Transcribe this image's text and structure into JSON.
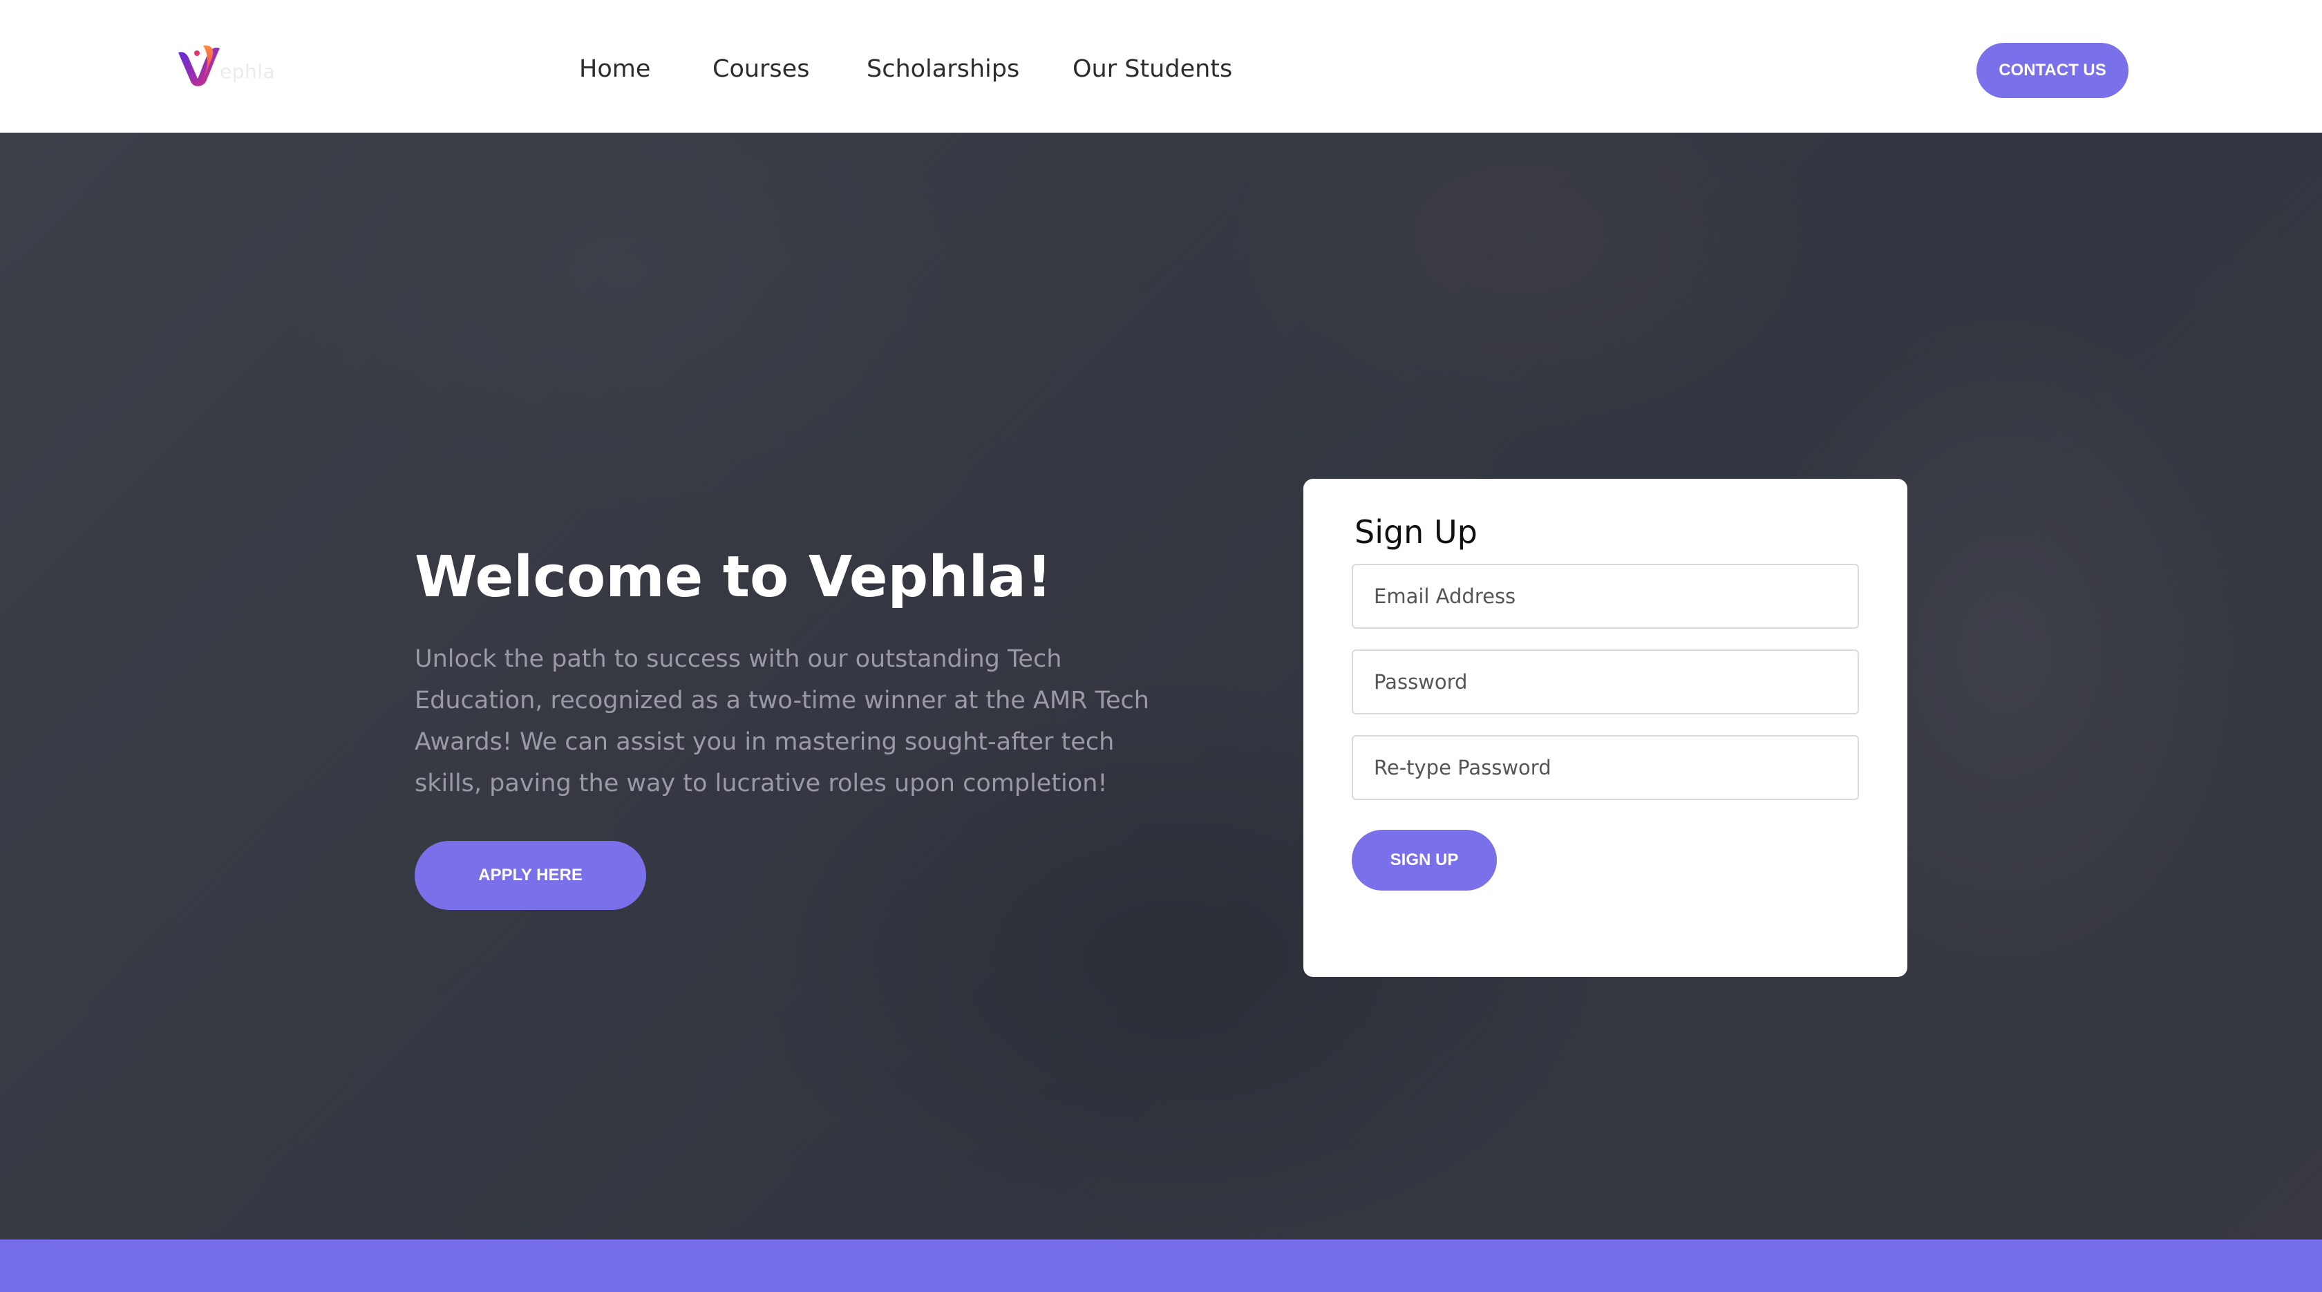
{
  "brand": {
    "logo_text": "ephla",
    "accent_color": "#7a70ea"
  },
  "nav": {
    "items": [
      {
        "label": "Home"
      },
      {
        "label": "Courses"
      },
      {
        "label": "Scholarships"
      },
      {
        "label": "Our Students"
      }
    ],
    "contact_label": "CONTACT US"
  },
  "hero": {
    "title": "Welcome to Vephla!",
    "description": "Unlock the path to success with our outstanding Tech Education, recognized as a two-time winner at the AMR Tech Awards! We can assist you in mastering sought-after tech skills, paving the way to lucrative roles upon completion!",
    "apply_label": "APPLY HERE"
  },
  "signup": {
    "title": "Sign Up",
    "email_placeholder": "Email Address",
    "password_placeholder": "Password",
    "retype_placeholder": "Re-type Password",
    "button_label": "SIGN UP"
  }
}
